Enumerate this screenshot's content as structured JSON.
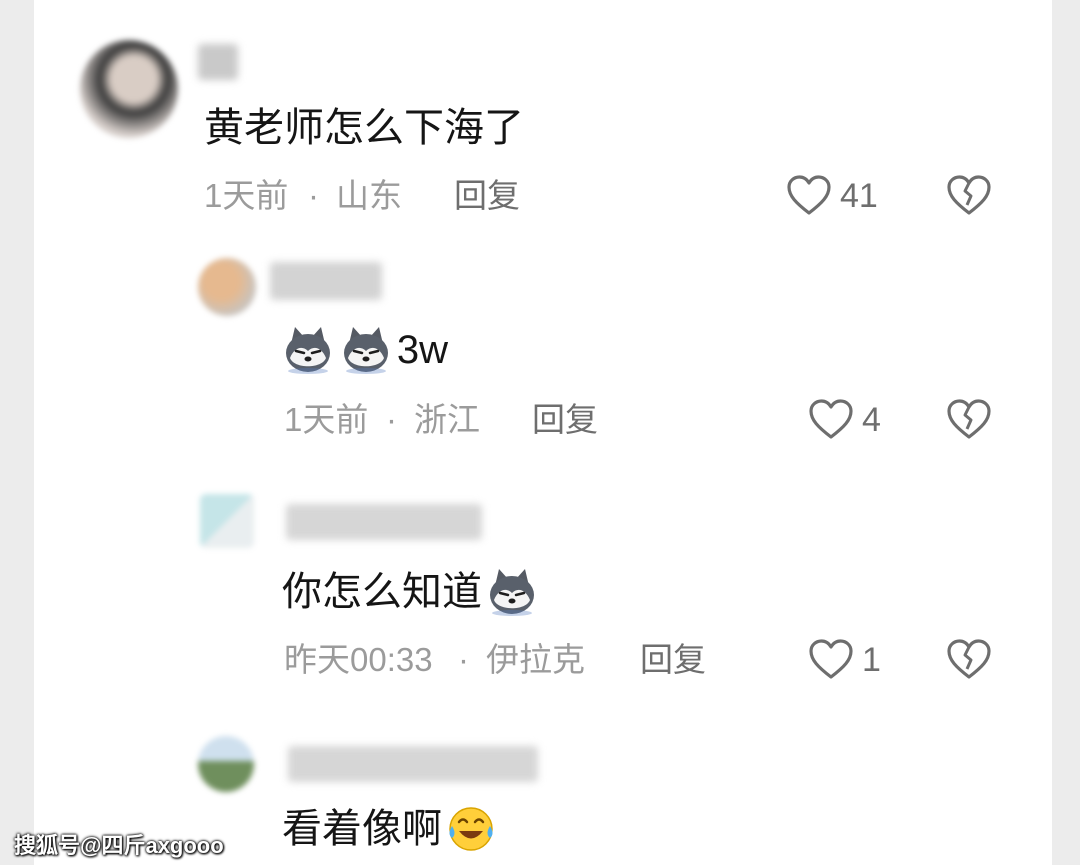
{
  "comments": [
    {
      "text": "黄老师怎么下海了",
      "time": "1天前",
      "location": "山东",
      "reply_label": "回复",
      "likes": "41"
    },
    {
      "text_suffix": "3w",
      "time": "1天前",
      "location": "浙江",
      "reply_label": "回复",
      "likes": "4"
    },
    {
      "text": "你怎么知道",
      "time": "昨天00:33",
      "location": "伊拉克",
      "reply_label": "回复",
      "likes": "1"
    },
    {
      "text": "看着像啊"
    }
  ],
  "separator": "·",
  "watermark": "搜狐号@四斤axgooo",
  "icons": {
    "like": "heart-outline-icon",
    "dislike": "broken-heart-icon",
    "emoji_dog": "husky-emoji-icon",
    "emoji_laugh": "laughing-tears-emoji-icon"
  },
  "colors": {
    "text": "#151515",
    "meta": "#9b9b9b",
    "action": "#6e6e6e",
    "background": "#ffffff"
  }
}
